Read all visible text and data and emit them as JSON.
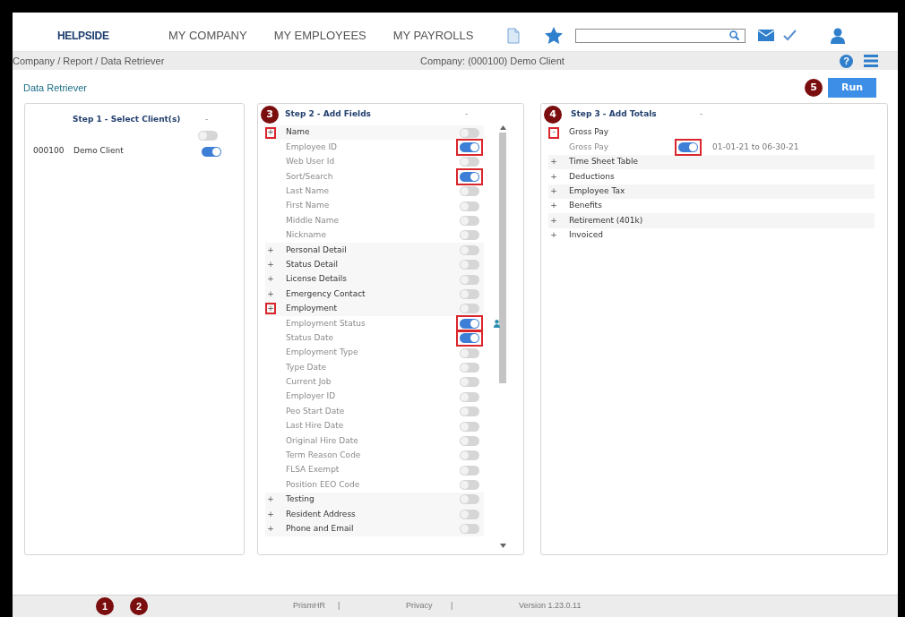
{
  "nav": {
    "logo": "HELPSIDE",
    "menu": [
      "MY COMPANY",
      "MY EMPLOYEES",
      "MY PAYROLLS"
    ]
  },
  "breadcrumb": "Company / Report / Data Retriever",
  "company": "Company: (000100) Demo Client",
  "help_glyph": "?",
  "page_title": "Data Retriever",
  "run_button": {
    "label": "Run",
    "badge": "5"
  },
  "step1": {
    "title": "Step 1 - Select Client(s)",
    "collapse_sign": "-",
    "select_all": {
      "on": false
    },
    "clients": [
      {
        "code": "000100",
        "name": "Demo Client",
        "on": true
      }
    ]
  },
  "step2": {
    "title": "Step 2 - Add Fields",
    "badge": "3",
    "collapse_sign": "-",
    "fields": [
      {
        "sign": "+",
        "label": "Name",
        "on": false,
        "highlighted": true,
        "children": [
          {
            "label": "Employee ID",
            "on": true,
            "highlighted": true
          },
          {
            "label": "Web User Id",
            "on": false,
            "highlighted": false
          },
          {
            "label": "Sort/Search",
            "on": true,
            "highlighted": true
          },
          {
            "label": "Last Name",
            "on": false,
            "highlighted": false
          },
          {
            "label": "First Name",
            "on": false,
            "highlighted": false
          },
          {
            "label": "Middle Name",
            "on": false,
            "highlighted": false
          },
          {
            "label": "Nickname",
            "on": false,
            "highlighted": false
          }
        ]
      },
      {
        "sign": "+",
        "label": "Personal Detail",
        "on": false,
        "highlighted": false
      },
      {
        "sign": "+",
        "label": "Status Detail",
        "on": false,
        "highlighted": false
      },
      {
        "sign": "+",
        "label": "License Details",
        "on": false,
        "highlighted": false
      },
      {
        "sign": "+",
        "label": "Emergency Contact",
        "on": false,
        "highlighted": false
      },
      {
        "sign": "+",
        "label": "Employment",
        "on": false,
        "highlighted": true,
        "children": [
          {
            "label": "Employment Status",
            "on": true,
            "highlighted": true,
            "person_icon": true
          },
          {
            "label": "Status Date",
            "on": true,
            "highlighted": true
          },
          {
            "label": "Employment Type",
            "on": false,
            "highlighted": false
          },
          {
            "label": "Type Date",
            "on": false,
            "highlighted": false
          },
          {
            "label": "Current Job",
            "on": false,
            "highlighted": false
          },
          {
            "label": "Employer ID",
            "on": false,
            "highlighted": false
          },
          {
            "label": "Peo Start Date",
            "on": false,
            "highlighted": false
          },
          {
            "label": "Last Hire Date",
            "on": false,
            "highlighted": false
          },
          {
            "label": "Original Hire Date",
            "on": false,
            "highlighted": false
          },
          {
            "label": "Term Reason Code",
            "on": false,
            "highlighted": false
          },
          {
            "label": "FLSA Exempt",
            "on": false,
            "highlighted": false
          },
          {
            "label": "Position EEO Code",
            "on": false,
            "highlighted": false
          }
        ]
      },
      {
        "sign": "+",
        "label": "Testing",
        "on": false,
        "highlighted": false
      },
      {
        "sign": "+",
        "label": "Resident Address",
        "on": false,
        "highlighted": false
      },
      {
        "sign": "+",
        "label": "Phone and Email",
        "on": false,
        "highlighted": false
      }
    ]
  },
  "step3": {
    "title": "Step 3 - Add Totals",
    "badge": "4",
    "collapse_sign": "-",
    "totals": [
      {
        "sign": "-",
        "label": "Gross Pay",
        "highlighted": true,
        "children": [
          {
            "label": "Gross Pay",
            "on": true,
            "highlighted": true,
            "range": "01-01-21 to 06-30-21"
          }
        ]
      },
      {
        "sign": "+",
        "label": "Time Sheet Table",
        "highlighted": false
      },
      {
        "sign": "+",
        "label": "Deductions",
        "highlighted": false
      },
      {
        "sign": "+",
        "label": "Employee Tax",
        "highlighted": false
      },
      {
        "sign": "+",
        "label": "Benefits",
        "highlighted": false
      },
      {
        "sign": "+",
        "label": "Retirement (401k)",
        "highlighted": false
      },
      {
        "sign": "+",
        "label": "Invoiced",
        "highlighted": false
      }
    ]
  },
  "footer": {
    "badges": [
      "1",
      "2"
    ],
    "links": [
      "PrismHR",
      "Privacy"
    ],
    "separators": [
      "|",
      "|"
    ],
    "version": "Version 1.23.0.11"
  }
}
